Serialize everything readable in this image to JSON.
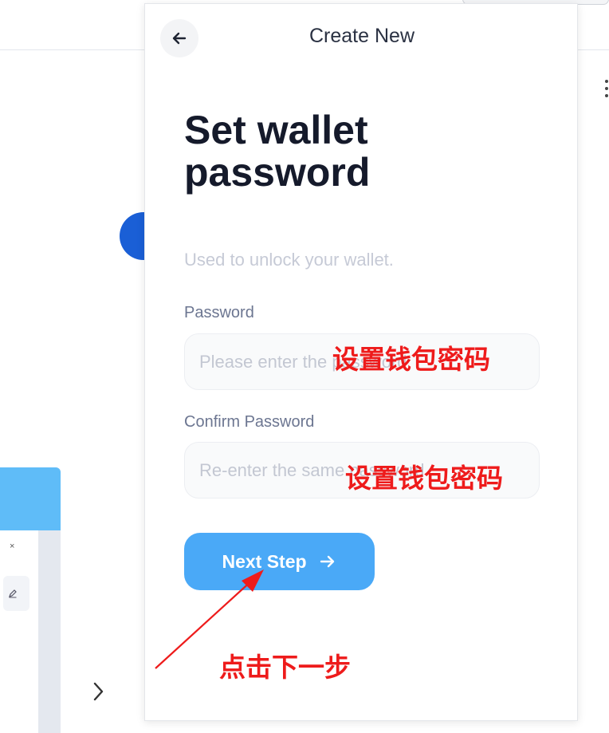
{
  "popup": {
    "title": "Create New",
    "heading": "Set wallet password",
    "subtitle": "Used to unlock your wallet.",
    "password": {
      "label": "Password",
      "placeholder": "Please enter the password",
      "value": ""
    },
    "confirm_password": {
      "label": "Confirm Password",
      "placeholder": "Re-enter the same password",
      "value": ""
    },
    "next_button": {
      "label": "Next Step"
    }
  },
  "background": {
    "card_close_glyph": "×"
  },
  "annotations": {
    "password_note": "设置钱包密码",
    "confirm_note": "设置钱包密码",
    "button_note": "点击下一步"
  },
  "colors": {
    "accent_button": "#4aa9f7",
    "annotation": "#ee1b1b",
    "heading": "#151a2b"
  },
  "icons": [
    "arrow-left-icon",
    "arrow-right-icon",
    "more-vertical-icon",
    "pencil-icon",
    "chevron-right-icon",
    "close-icon"
  ]
}
